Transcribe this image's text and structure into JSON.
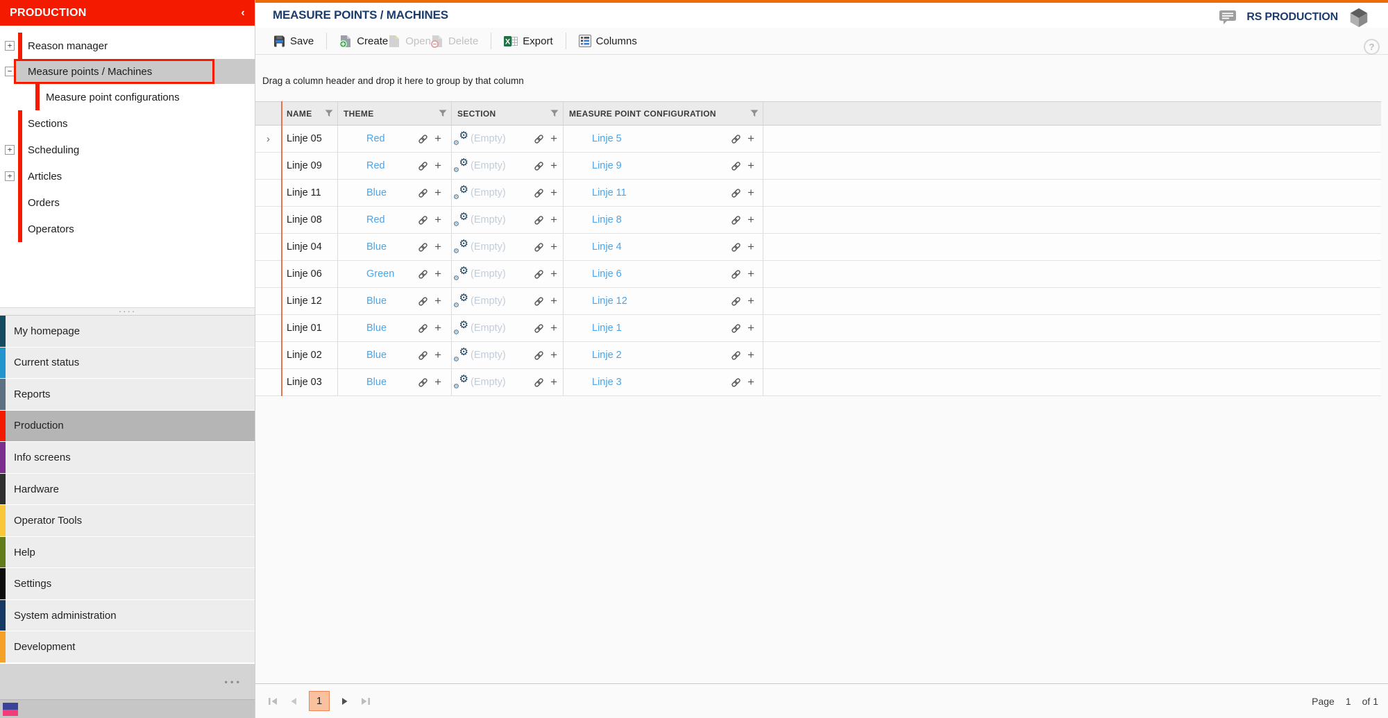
{
  "sidebar": {
    "header": {
      "title": "PRODUCTION",
      "collapse_icon": "‹"
    },
    "tree": [
      {
        "label": "Reason manager",
        "expander": "+",
        "bar": true,
        "level": 0,
        "selected": false
      },
      {
        "label": "Measure points / Machines",
        "expander": "−",
        "bar": false,
        "level": 0,
        "selected": true
      },
      {
        "label": "Measure point configurations",
        "expander": "",
        "bar": true,
        "level": 1,
        "selected": false
      },
      {
        "label": "Sections",
        "expander": "",
        "bar": true,
        "level": 0,
        "selected": false
      },
      {
        "label": "Scheduling",
        "expander": "+",
        "bar": true,
        "level": 0,
        "selected": false
      },
      {
        "label": "Articles",
        "expander": "+",
        "bar": true,
        "level": 0,
        "selected": false
      },
      {
        "label": "Orders",
        "expander": "",
        "bar": true,
        "level": 0,
        "selected": false
      },
      {
        "label": "Operators",
        "expander": "",
        "bar": true,
        "level": 0,
        "selected": false
      }
    ],
    "menu": [
      {
        "label": "My homepage",
        "stripe": "#164a5f",
        "selected": false
      },
      {
        "label": "Current status",
        "stripe": "#2395cc",
        "selected": false
      },
      {
        "label": "Reports",
        "stripe": "#5e7183",
        "selected": false
      },
      {
        "label": "Production",
        "stripe": "#f41a00",
        "selected": true
      },
      {
        "label": "Info screens",
        "stripe": "#7c2e8e",
        "selected": false
      },
      {
        "label": "Hardware",
        "stripe": "#2f2f2f",
        "selected": false
      },
      {
        "label": "Operator Tools",
        "stripe": "#f8c839",
        "selected": false
      },
      {
        "label": "Help",
        "stripe": "#627c1a",
        "selected": false
      },
      {
        "label": "Settings",
        "stripe": "#0c0c0c",
        "selected": false
      },
      {
        "label": "System administration",
        "stripe": "#173a64",
        "selected": false
      },
      {
        "label": "Development",
        "stripe": "#f4a227",
        "selected": false
      }
    ],
    "splitter_dots": "····",
    "overflow_dots": "•••"
  },
  "titlebar": {
    "title": "MEASURE POINTS / MACHINES",
    "brand": "RS PRODUCTION",
    "help_icon": "?"
  },
  "toolbar": {
    "save": "Save",
    "create": "Create",
    "open": "Open",
    "delete": "Delete",
    "export": "Export",
    "columns": "Columns"
  },
  "grid": {
    "group_hint": "Drag a column header and drop it here to group by that column",
    "columns": [
      "NAME",
      "THEME",
      "SECTION",
      "MEASURE POINT CONFIGURATION"
    ],
    "empty_label": "(Empty)",
    "row_expander": "›",
    "plus_icon": "+",
    "gear_icon": "⚙",
    "rows": [
      {
        "name": "Linje 05",
        "theme": "Red",
        "section": "(Empty)",
        "config": "Linje 5"
      },
      {
        "name": "Linje 09",
        "theme": "Red",
        "section": "(Empty)",
        "config": "Linje 9"
      },
      {
        "name": "Linje 11",
        "theme": "Blue",
        "section": "(Empty)",
        "config": "Linje 11"
      },
      {
        "name": "Linje 08",
        "theme": "Red",
        "section": "(Empty)",
        "config": "Linje 8"
      },
      {
        "name": "Linje 04",
        "theme": "Blue",
        "section": "(Empty)",
        "config": "Linje 4"
      },
      {
        "name": "Linje 06",
        "theme": "Green",
        "section": "(Empty)",
        "config": "Linje 6"
      },
      {
        "name": "Linje 12",
        "theme": "Blue",
        "section": "(Empty)",
        "config": "Linje 12"
      },
      {
        "name": "Linje 01",
        "theme": "Blue",
        "section": "(Empty)",
        "config": "Linje 1"
      },
      {
        "name": "Linje 02",
        "theme": "Blue",
        "section": "(Empty)",
        "config": "Linje 2"
      },
      {
        "name": "Linje 03",
        "theme": "Blue",
        "section": "(Empty)",
        "config": "Linje 3"
      }
    ]
  },
  "pager": {
    "page_box": "1",
    "page_label": "Page",
    "page_number": "1",
    "of_label": "of 1"
  },
  "colors": {
    "accent_red": "#f41a00",
    "top_orange": "#ee6c05",
    "brand_navy": "#1b3c6d",
    "link_blue": "#4ba4e8",
    "row_accent_line": "#e8734f",
    "pager_box_bg": "#fac19e",
    "pager_box_border": "#ee8455"
  }
}
